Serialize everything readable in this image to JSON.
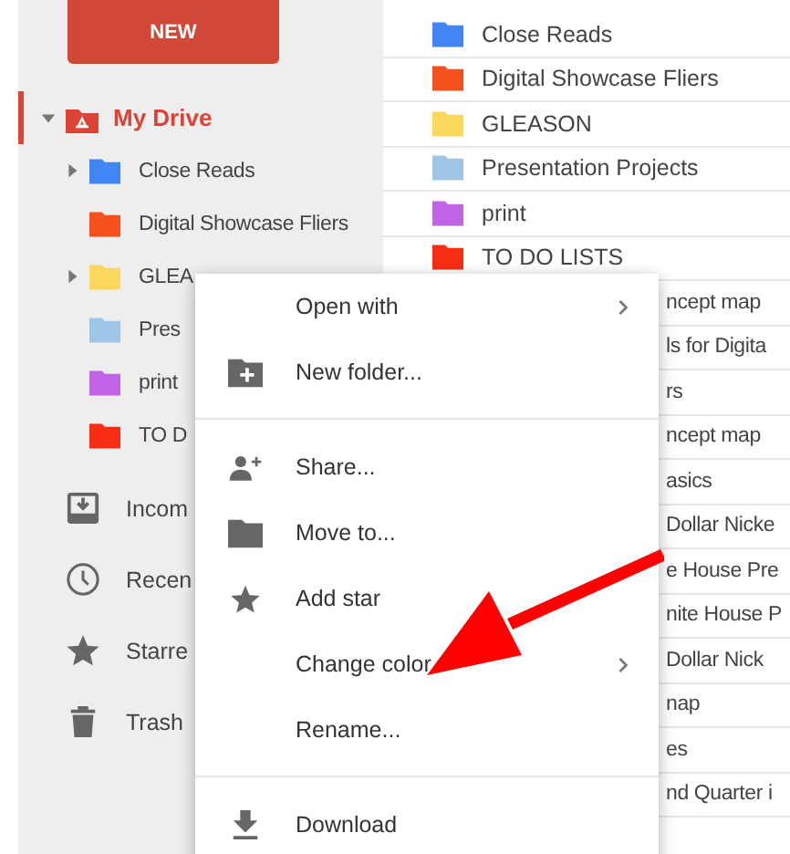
{
  "sidebar": {
    "new_button": "NEW",
    "drive": {
      "label": "My Drive",
      "selected": true,
      "expanded": true,
      "children": [
        {
          "label": "Close Reads",
          "color": "#4285f4",
          "expandable": true
        },
        {
          "label": "Digital Showcase Fliers",
          "color": "#f4511e",
          "expandable": false
        },
        {
          "label": "GLEA",
          "color": "#fbd75b",
          "expandable": true
        },
        {
          "label": "Pres",
          "color": "#9fc6e7",
          "expandable": false
        },
        {
          "label": "print",
          "color": "#c264e6",
          "expandable": false
        },
        {
          "label": "TO D",
          "color": "#f72d14",
          "expandable": false
        }
      ]
    },
    "items": [
      {
        "label": "Incom",
        "kind": "inbox",
        "selected": false
      },
      {
        "label": "Recen",
        "kind": "clock",
        "selected": false
      },
      {
        "label": "Starre",
        "kind": "star",
        "selected": false
      },
      {
        "label": "Trash",
        "kind": "trash",
        "selected": false
      }
    ]
  },
  "file_list": [
    {
      "kind": "folder",
      "name": "Close Reads",
      "color": "#4285f4"
    },
    {
      "kind": "folder",
      "name": "Digital Showcase Fliers",
      "color": "#f4511e"
    },
    {
      "kind": "folder",
      "name": "GLEASON",
      "color": "#fbd75b"
    },
    {
      "kind": "folder",
      "name": "Presentation Projects",
      "color": "#9fc6e7"
    },
    {
      "kind": "folder",
      "name": "print",
      "color": "#c264e6"
    },
    {
      "kind": "folder",
      "name": "TO DO LISTS",
      "color": "#f72d14"
    },
    {
      "kind": "fragment",
      "name": "ncept map"
    },
    {
      "kind": "fragment",
      "name": "ls for Digita"
    },
    {
      "kind": "fragment",
      "name": "rs"
    },
    {
      "kind": "fragment",
      "name": "ncept map"
    },
    {
      "kind": "fragment",
      "name": "asics"
    },
    {
      "kind": "fragment",
      "name": "Dollar Nicke"
    },
    {
      "kind": "fragment",
      "name": "e House Pre"
    },
    {
      "kind": "fragment",
      "name": "nite House P"
    },
    {
      "kind": "fragment",
      "name": "Dollar Nick"
    },
    {
      "kind": "fragment",
      "name": "nap"
    },
    {
      "kind": "fragment",
      "name": "es"
    },
    {
      "kind": "fragment",
      "name": "nd Quarter i"
    }
  ],
  "context_menu": [
    {
      "kind": "plain",
      "label": "Open with",
      "submenu": true
    },
    {
      "kind": "new-folder",
      "label": "New folder...",
      "submenu": false
    },
    {
      "kind": "divider"
    },
    {
      "kind": "share",
      "label": "Share...",
      "submenu": false
    },
    {
      "kind": "folder",
      "label": "Move to...",
      "submenu": false
    },
    {
      "kind": "star",
      "label": "Add star",
      "submenu": false
    },
    {
      "kind": "plain",
      "label": "Change color",
      "submenu": true
    },
    {
      "kind": "plain",
      "label": "Rename...",
      "submenu": false
    },
    {
      "kind": "divider"
    },
    {
      "kind": "download",
      "label": "Download",
      "submenu": false
    }
  ]
}
